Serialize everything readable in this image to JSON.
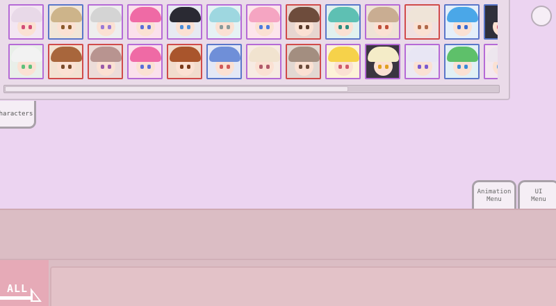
{
  "tabs": {
    "characters_label": "haracters",
    "animation_menu_label": "Animation\nMenu",
    "ui_menu_label": "UI\nMenu"
  },
  "filter": {
    "all_label": "ALL"
  },
  "grid": {
    "rows": [
      [
        {
          "border": "#b56ad6",
          "bg": "#f3e6f2",
          "hair": "#e8d9e8",
          "eye": "#d24d77"
        },
        {
          "border": "#5a76c9",
          "bg": "#f1e6d8",
          "hair": "#cdb48a",
          "eye": "#8b5a2b"
        },
        {
          "border": "#b56ad6",
          "bg": "#eeeeee",
          "hair": "#d4d4d4",
          "eye": "#9a7ad6"
        },
        {
          "border": "#b56ad6",
          "bg": "#fbe0ec",
          "hair": "#ef6aa5",
          "eye": "#5a6ed8"
        },
        {
          "border": "#b56ad6",
          "bg": "#e7eaf2",
          "hair": "#2a2a33",
          "eye": "#4a8dd8"
        },
        {
          "border": "#b56ad6",
          "bg": "#e6f2f4",
          "hair": "#9ed7e0",
          "eye": "#8a9a9a"
        },
        {
          "border": "#b56ad6",
          "bg": "#fde5ec",
          "hair": "#f5a5c2",
          "eye": "#4b7be0"
        },
        {
          "border": "#d04a4a",
          "bg": "#e7d6d0",
          "hair": "#6e4c3c",
          "eye": "#5a3b2b"
        },
        {
          "border": "#5a76c9",
          "bg": "#e1f1ef",
          "hair": "#5ec0b3",
          "eye": "#2c8c7f"
        },
        {
          "border": "#b56ad6",
          "bg": "#efe3d6",
          "hair": "#c9ad92",
          "eye": "#c0503a"
        },
        {
          "border": "#d04a4a",
          "bg": "#f0e0e0",
          "hair": "#efe4d8",
          "eye": "#b0694a"
        },
        {
          "border": "#5a76c9",
          "bg": "#e4effa",
          "hair": "#4aa7e8",
          "eye": "#3a6ad0"
        },
        {
          "border": "#5a76c9",
          "bg": "#2f2f3a",
          "hair": "#30303c",
          "eye": "#d04a6a"
        }
      ],
      [
        {
          "border": "#b56ad6",
          "bg": "#e9efe9",
          "hair": "#f2f2f2",
          "eye": "#5ec07a"
        },
        {
          "border": "#d04a4a",
          "bg": "#f3e2d2",
          "hair": "#a8663c",
          "eye": "#7a4b2b"
        },
        {
          "border": "#d04a4a",
          "bg": "#ecdcd9",
          "hair": "#b89490",
          "eye": "#9a5aa8"
        },
        {
          "border": "#b56ad6",
          "bg": "#fbe0ec",
          "hair": "#ef6aa5",
          "eye": "#5a6ed8"
        },
        {
          "border": "#d04a4a",
          "bg": "#f1dccd",
          "hair": "#a9552c",
          "eye": "#7a3a1a"
        },
        {
          "border": "#5a76c9",
          "bg": "#e3e8f6",
          "hair": "#6f8fd8",
          "eye": "#d05a5a"
        },
        {
          "border": "#b56ad6",
          "bg": "#f7ebe3",
          "hair": "#f1e3cf",
          "eye": "#b05a6a"
        },
        {
          "border": "#d04a4a",
          "bg": "#e2d8d2",
          "hair": "#a38e80",
          "eye": "#6a4a3a"
        },
        {
          "border": "#b56ad6",
          "bg": "#fdf3d8",
          "hair": "#f6d24a",
          "eye": "#d05a6a"
        },
        {
          "border": "#b56ad6",
          "bg": "#3a3540",
          "hair": "#f4ecc8",
          "eye": "#e0a020"
        },
        {
          "border": "#b56ad6",
          "bg": "#ece9f2",
          "hair": "#e8e6f4",
          "eye": "#7a5ad0"
        },
        {
          "border": "#5a76c9",
          "bg": "#e1f0f5",
          "hair": "#5ec06a",
          "eye": "#3a8ad8"
        },
        {
          "border": "#b56ad6",
          "bg": "#f4e8ef",
          "hair": "#ede6ee",
          "eye": "#5aa0e0"
        }
      ]
    ]
  }
}
